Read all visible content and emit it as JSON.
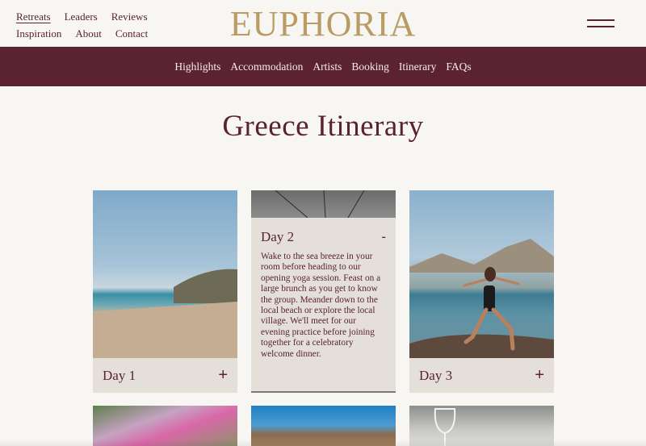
{
  "header": {
    "nav_row1": [
      "Retreats",
      "Leaders",
      "Reviews"
    ],
    "nav_row2": [
      "Inspiration",
      "About",
      "Contact"
    ],
    "logo": "EUPHORIA"
  },
  "subnav": {
    "items": [
      "Highlights",
      "Accommodation",
      "Artists",
      "Booking",
      "Itinerary",
      "FAQs"
    ]
  },
  "page": {
    "title": "Greece Itinerary"
  },
  "cards": [
    {
      "label": "Day 1",
      "toggle": "+"
    },
    {
      "label": "Day 2",
      "toggle": "-",
      "description": "Wake to the sea breeze in your room before heading to our opening yoga session. Feast on a large brunch as you get to know the group. Meander down to the local beach or explore the local village. We'll meet for our evening practice before joining together for a celebratory welcome dinner."
    },
    {
      "label": "Day 3",
      "toggle": "+"
    }
  ],
  "colors": {
    "maroon": "#5b2332",
    "gold": "#b99c64",
    "background": "#f8f6f3",
    "card_bar": "#e4e0d9"
  }
}
